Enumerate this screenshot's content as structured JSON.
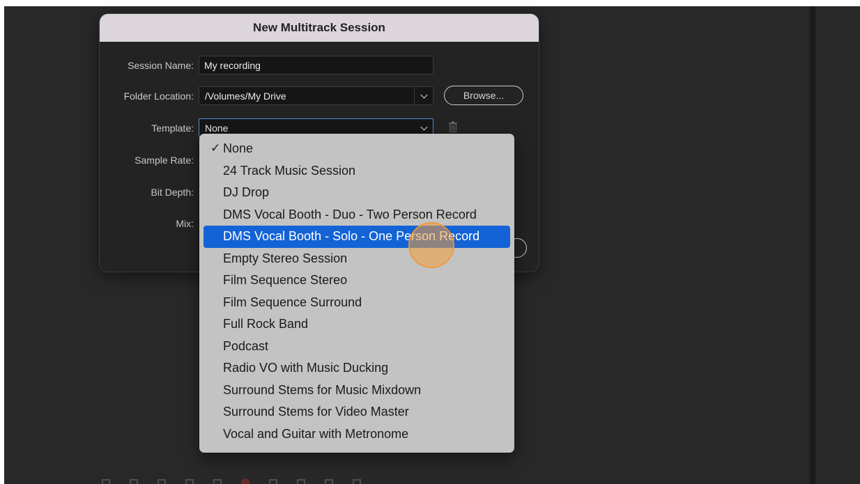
{
  "dialog": {
    "title": "New Multitrack Session",
    "session_name_label": "Session Name:",
    "session_name_value": "My recording",
    "folder_location_label": "Folder Location:",
    "folder_location_value": "/Volumes/My Drive",
    "browse_label": "Browse...",
    "template_label": "Template:",
    "template_value": "None",
    "sample_rate_label": "Sample Rate:",
    "bit_depth_label": "Bit Depth:",
    "mix_label": "Mix:"
  },
  "dropdown": {
    "items": [
      {
        "label": "None",
        "checked": true
      },
      {
        "label": "24 Track Music Session"
      },
      {
        "label": "DJ Drop"
      },
      {
        "label": "DMS Vocal Booth - Duo - Two Person Record"
      },
      {
        "label": "DMS Vocal Booth - Solo - One Person Record",
        "highlighted": true
      },
      {
        "label": "Empty Stereo Session"
      },
      {
        "label": "Film Sequence Stereo"
      },
      {
        "label": "Film Sequence Surround"
      },
      {
        "label": "Full Rock Band"
      },
      {
        "label": "Podcast"
      },
      {
        "label": "Radio VO with Music Ducking"
      },
      {
        "label": "Surround Stems for Music Mixdown"
      },
      {
        "label": "Surround Stems for Video Master"
      },
      {
        "label": "Vocal and Guitar with Metronome"
      }
    ]
  },
  "colors": {
    "selection": "#1363d6",
    "menu_bg": "#c3c3c3",
    "app_bg": "#282828",
    "click_indicator": "#f69e3e"
  }
}
